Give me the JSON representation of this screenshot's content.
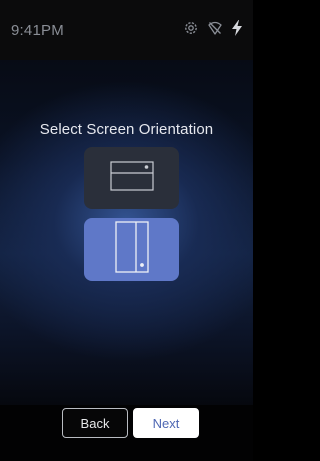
{
  "status_bar": {
    "time": "9:41PM",
    "icons": [
      "gear-icon",
      "wifi-off-icon",
      "lightning-icon"
    ]
  },
  "screen": {
    "title": "Select Screen Orientation",
    "options": [
      {
        "name": "landscape",
        "selected": false
      },
      {
        "name": "portrait",
        "selected": true
      }
    ]
  },
  "footer": {
    "back_label": "Back",
    "next_label": "Next"
  },
  "colors": {
    "selected_option": "#5f78c8",
    "unselected_option": "#2a2f3a",
    "next_text": "#4e67b3"
  }
}
